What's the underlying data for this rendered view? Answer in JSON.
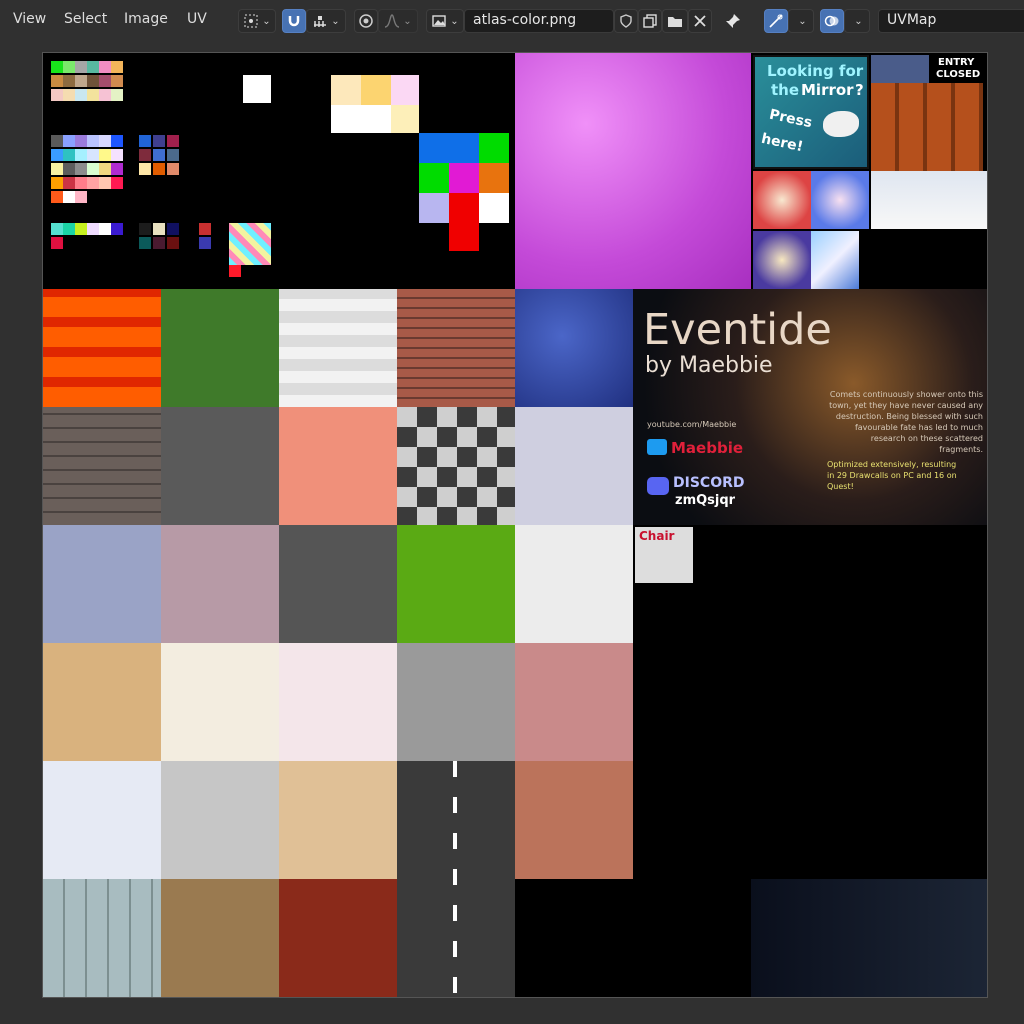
{
  "menu": {
    "view": "View",
    "select": "Select",
    "image": "Image",
    "uv": "UV"
  },
  "toolbar": {
    "image_name": "atlas-color.png",
    "uv_map": "UVMap"
  },
  "colors": {
    "editor_bg": "#303030",
    "active_button": "#4772b3",
    "field_bg": "#1d1d1d"
  },
  "atlas": {
    "mirror_sign": {
      "line1": "Looking for",
      "line2": "the",
      "mirror_word": "Mirror",
      "question": "?",
      "press": "Press",
      "here": "here!"
    },
    "entry_sign": {
      "line1": "ENTRY",
      "line2": "CLOSED"
    },
    "banner": {
      "title": "Eventide",
      "subtitle": "by Maebbie",
      "youtube": "youtube.com/Maebbie",
      "twitter_handle": "Maebbie",
      "discord_label": "DISCORD",
      "discord_code": "zmQsjqr",
      "story": "Comets continuously shower onto this town, yet they have never caused any destruction. Being blessed with such favourable fate has led to much research on these scattered fragments.",
      "optimized": "Optimized extensively, resulting in 29 Drawcalls on PC and 16 on Quest!"
    },
    "chair_sign": {
      "title": "Chair"
    }
  }
}
